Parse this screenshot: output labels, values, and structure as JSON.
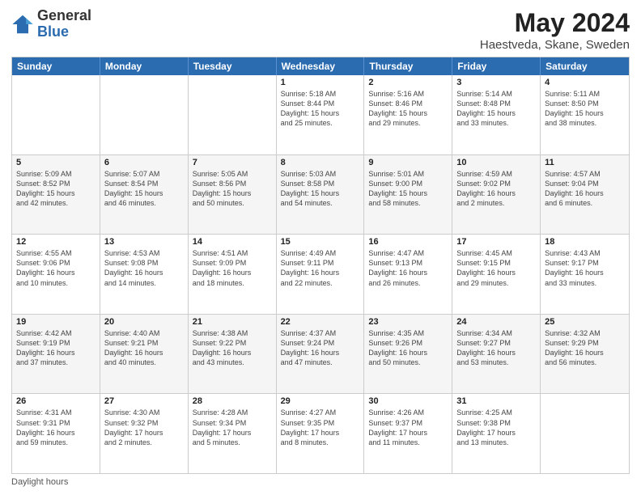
{
  "logo": {
    "general": "General",
    "blue": "Blue"
  },
  "title": {
    "month": "May 2024",
    "location": "Haestveda, Skane, Sweden"
  },
  "days": [
    "Sunday",
    "Monday",
    "Tuesday",
    "Wednesday",
    "Thursday",
    "Friday",
    "Saturday"
  ],
  "weeks": [
    [
      {
        "date": "",
        "info": ""
      },
      {
        "date": "",
        "info": ""
      },
      {
        "date": "",
        "info": ""
      },
      {
        "date": "1",
        "info": "Sunrise: 5:18 AM\nSunset: 8:44 PM\nDaylight: 15 hours\nand 25 minutes."
      },
      {
        "date": "2",
        "info": "Sunrise: 5:16 AM\nSunset: 8:46 PM\nDaylight: 15 hours\nand 29 minutes."
      },
      {
        "date": "3",
        "info": "Sunrise: 5:14 AM\nSunset: 8:48 PM\nDaylight: 15 hours\nand 33 minutes."
      },
      {
        "date": "4",
        "info": "Sunrise: 5:11 AM\nSunset: 8:50 PM\nDaylight: 15 hours\nand 38 minutes."
      }
    ],
    [
      {
        "date": "5",
        "info": "Sunrise: 5:09 AM\nSunset: 8:52 PM\nDaylight: 15 hours\nand 42 minutes."
      },
      {
        "date": "6",
        "info": "Sunrise: 5:07 AM\nSunset: 8:54 PM\nDaylight: 15 hours\nand 46 minutes."
      },
      {
        "date": "7",
        "info": "Sunrise: 5:05 AM\nSunset: 8:56 PM\nDaylight: 15 hours\nand 50 minutes."
      },
      {
        "date": "8",
        "info": "Sunrise: 5:03 AM\nSunset: 8:58 PM\nDaylight: 15 hours\nand 54 minutes."
      },
      {
        "date": "9",
        "info": "Sunrise: 5:01 AM\nSunset: 9:00 PM\nDaylight: 15 hours\nand 58 minutes."
      },
      {
        "date": "10",
        "info": "Sunrise: 4:59 AM\nSunset: 9:02 PM\nDaylight: 16 hours\nand 2 minutes."
      },
      {
        "date": "11",
        "info": "Sunrise: 4:57 AM\nSunset: 9:04 PM\nDaylight: 16 hours\nand 6 minutes."
      }
    ],
    [
      {
        "date": "12",
        "info": "Sunrise: 4:55 AM\nSunset: 9:06 PM\nDaylight: 16 hours\nand 10 minutes."
      },
      {
        "date": "13",
        "info": "Sunrise: 4:53 AM\nSunset: 9:08 PM\nDaylight: 16 hours\nand 14 minutes."
      },
      {
        "date": "14",
        "info": "Sunrise: 4:51 AM\nSunset: 9:09 PM\nDaylight: 16 hours\nand 18 minutes."
      },
      {
        "date": "15",
        "info": "Sunrise: 4:49 AM\nSunset: 9:11 PM\nDaylight: 16 hours\nand 22 minutes."
      },
      {
        "date": "16",
        "info": "Sunrise: 4:47 AM\nSunset: 9:13 PM\nDaylight: 16 hours\nand 26 minutes."
      },
      {
        "date": "17",
        "info": "Sunrise: 4:45 AM\nSunset: 9:15 PM\nDaylight: 16 hours\nand 29 minutes."
      },
      {
        "date": "18",
        "info": "Sunrise: 4:43 AM\nSunset: 9:17 PM\nDaylight: 16 hours\nand 33 minutes."
      }
    ],
    [
      {
        "date": "19",
        "info": "Sunrise: 4:42 AM\nSunset: 9:19 PM\nDaylight: 16 hours\nand 37 minutes."
      },
      {
        "date": "20",
        "info": "Sunrise: 4:40 AM\nSunset: 9:21 PM\nDaylight: 16 hours\nand 40 minutes."
      },
      {
        "date": "21",
        "info": "Sunrise: 4:38 AM\nSunset: 9:22 PM\nDaylight: 16 hours\nand 43 minutes."
      },
      {
        "date": "22",
        "info": "Sunrise: 4:37 AM\nSunset: 9:24 PM\nDaylight: 16 hours\nand 47 minutes."
      },
      {
        "date": "23",
        "info": "Sunrise: 4:35 AM\nSunset: 9:26 PM\nDaylight: 16 hours\nand 50 minutes."
      },
      {
        "date": "24",
        "info": "Sunrise: 4:34 AM\nSunset: 9:27 PM\nDaylight: 16 hours\nand 53 minutes."
      },
      {
        "date": "25",
        "info": "Sunrise: 4:32 AM\nSunset: 9:29 PM\nDaylight: 16 hours\nand 56 minutes."
      }
    ],
    [
      {
        "date": "26",
        "info": "Sunrise: 4:31 AM\nSunset: 9:31 PM\nDaylight: 16 hours\nand 59 minutes."
      },
      {
        "date": "27",
        "info": "Sunrise: 4:30 AM\nSunset: 9:32 PM\nDaylight: 17 hours\nand 2 minutes."
      },
      {
        "date": "28",
        "info": "Sunrise: 4:28 AM\nSunset: 9:34 PM\nDaylight: 17 hours\nand 5 minutes."
      },
      {
        "date": "29",
        "info": "Sunrise: 4:27 AM\nSunset: 9:35 PM\nDaylight: 17 hours\nand 8 minutes."
      },
      {
        "date": "30",
        "info": "Sunrise: 4:26 AM\nSunset: 9:37 PM\nDaylight: 17 hours\nand 11 minutes."
      },
      {
        "date": "31",
        "info": "Sunrise: 4:25 AM\nSunset: 9:38 PM\nDaylight: 17 hours\nand 13 minutes."
      },
      {
        "date": "",
        "info": ""
      }
    ]
  ],
  "footer": {
    "daylight_hours": "Daylight hours"
  }
}
